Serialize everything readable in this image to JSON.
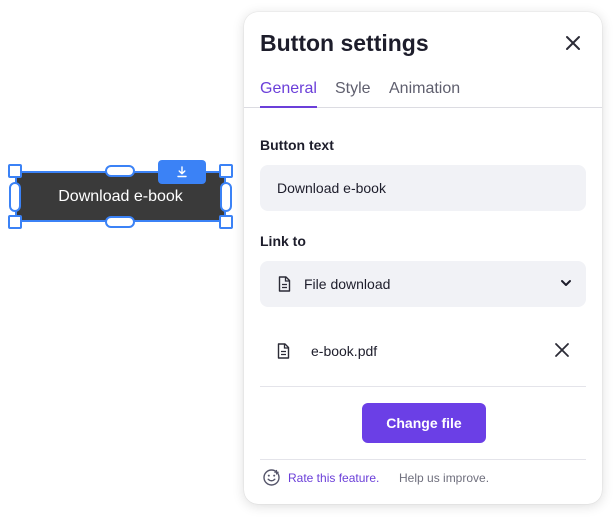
{
  "canvas": {
    "button_text": "Download e-book",
    "badge_icon": "download-icon",
    "selection_color": "#3b82f6"
  },
  "panel": {
    "title": "Button settings",
    "close_icon": "close-icon",
    "tabs": [
      {
        "label": "General",
        "active": true
      },
      {
        "label": "Style",
        "active": false
      },
      {
        "label": "Animation",
        "active": false
      }
    ],
    "button_text_label": "Button text",
    "button_text_value": "Download e-book",
    "link_to_label": "Link to",
    "link_to_value": "File download",
    "link_icon": "document-icon",
    "file_name": "e-book.pdf",
    "change_file_label": "Change file",
    "footer": {
      "rate_link": "Rate this feature.",
      "rate_text": "Help us improve.",
      "icon": "smiley-icon"
    },
    "accent_color": "#6b3fe6"
  }
}
